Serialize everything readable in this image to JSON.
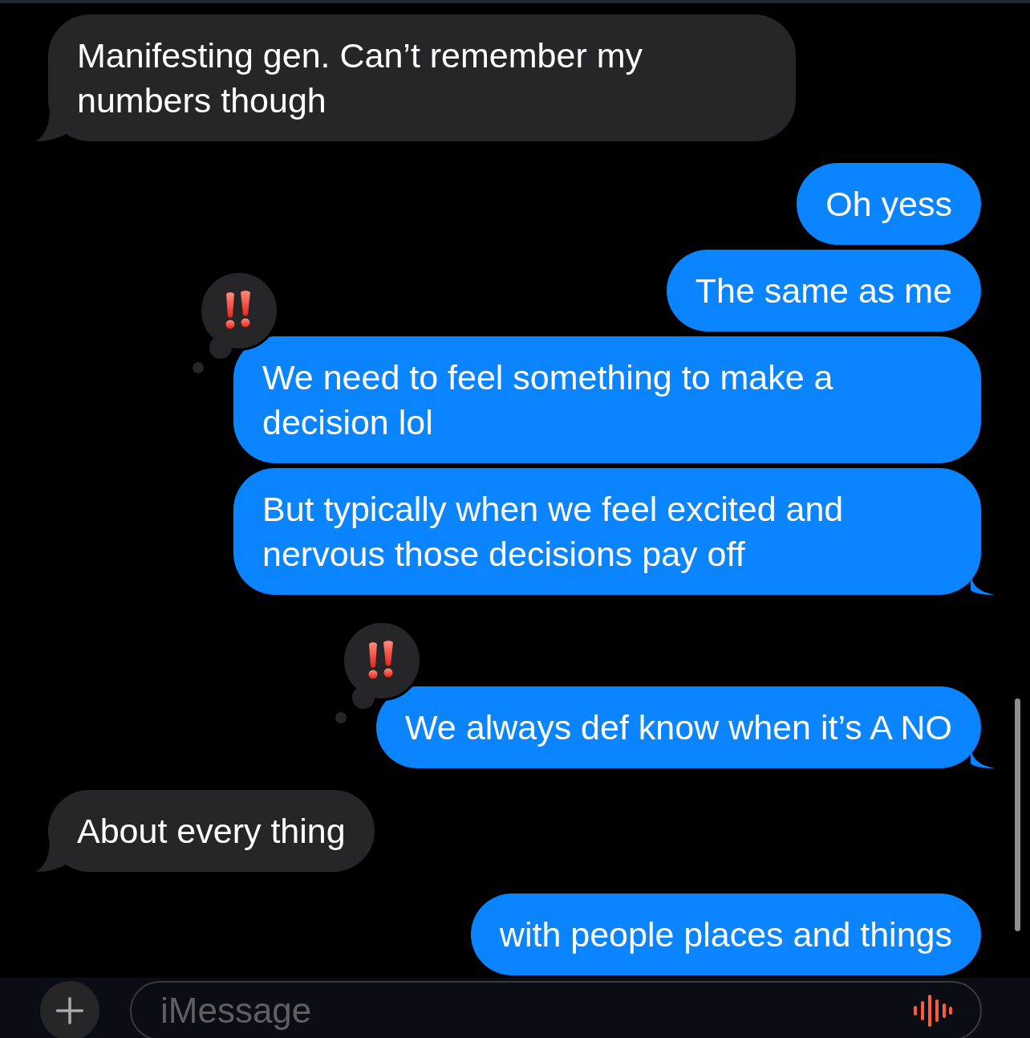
{
  "messages": [
    {
      "outgoing": false,
      "text": "Manifesting gen. Can’t remember my numbers though",
      "tail": true,
      "emphasized": false
    },
    {
      "outgoing": true,
      "text": "Oh yess",
      "tail": false,
      "emphasized": false
    },
    {
      "outgoing": true,
      "text": "The same as me",
      "tail": false,
      "emphasized": false
    },
    {
      "outgoing": true,
      "text": "We need to feel something to make a decision lol",
      "tail": false,
      "emphasized": true
    },
    {
      "outgoing": true,
      "text": "But typically when we feel excited and nervous those decisions pay off",
      "tail": true,
      "emphasized": false
    },
    {
      "outgoing": true,
      "text": "We always def know when it’s A NO",
      "tail": true,
      "emphasized": true
    },
    {
      "outgoing": false,
      "text": "About every thing",
      "tail": true,
      "emphasized": false
    },
    {
      "outgoing": true,
      "text": "with people places and things",
      "tail": false,
      "emphasized": false
    }
  ],
  "compose": {
    "placeholder": "iMessage"
  }
}
